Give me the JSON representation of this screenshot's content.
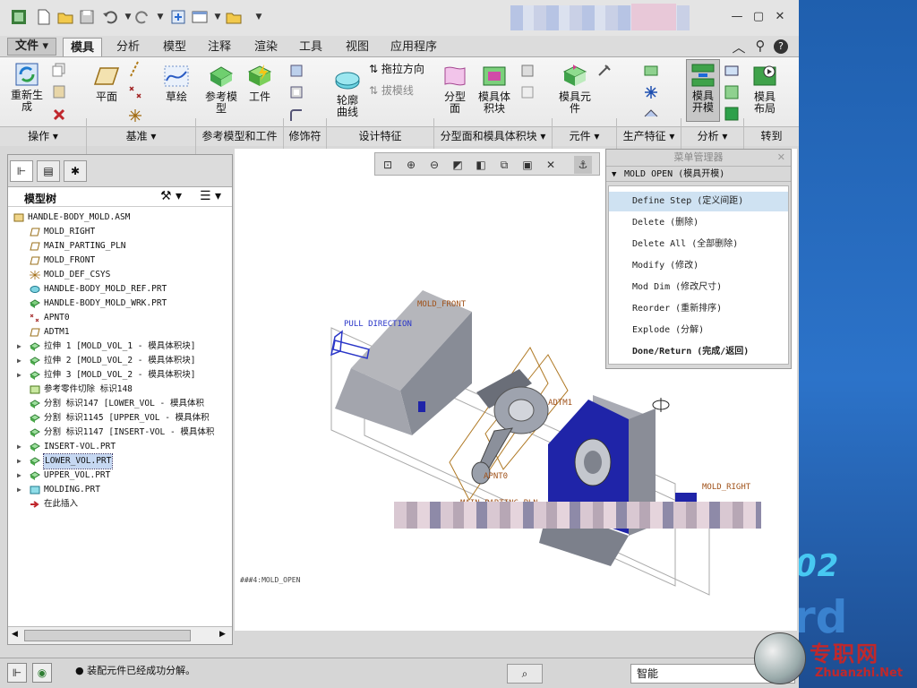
{
  "ribbon_tabs": [
    "文件",
    "模具",
    "分析",
    "模型",
    "注释",
    "渲染",
    "工具",
    "视图",
    "应用程序"
  ],
  "active_tab": "模具",
  "ribbon": {
    "regen": "重新生成",
    "plane": "平面",
    "sketch": "草绘",
    "refmodel": "参考模型",
    "workpiece": "工件",
    "contour_curve": "轮廓曲线",
    "drag_dir": "拖拉方向",
    "draft_line": "拔模线",
    "parting_surface": "分型面",
    "mold_volume": "模具体积块",
    "mold_component": "模具元件",
    "mold_open": "模具开模",
    "mold_layout": "模具布局"
  },
  "groups": [
    "操作",
    "基准",
    "参考模型和工件",
    "修饰符",
    "设计特征",
    "分型面和模具体积块",
    "元件",
    "生产特征",
    "分析",
    "转到"
  ],
  "left_panel": {
    "title": "模型树",
    "tree": [
      {
        "label": "HANDLE-BODY_MOLD.ASM",
        "indent": 0,
        "icon": "asm",
        "exp": ""
      },
      {
        "label": "MOLD_RIGHT",
        "indent": 1,
        "icon": "plane",
        "exp": ""
      },
      {
        "label": "MAIN_PARTING_PLN",
        "indent": 1,
        "icon": "plane",
        "exp": ""
      },
      {
        "label": "MOLD_FRONT",
        "indent": 1,
        "icon": "plane",
        "exp": ""
      },
      {
        "label": "MOLD_DEF_CSYS",
        "indent": 1,
        "icon": "csys",
        "exp": ""
      },
      {
        "label": "HANDLE-BODY_MOLD_REF.PRT",
        "indent": 1,
        "icon": "part",
        "exp": ""
      },
      {
        "label": "HANDLE-BODY_MOLD_WRK.PRT",
        "indent": 1,
        "icon": "part2",
        "exp": ""
      },
      {
        "label": "APNT0",
        "indent": 1,
        "icon": "point",
        "exp": ""
      },
      {
        "label": "ADTM1",
        "indent": 1,
        "icon": "plane",
        "exp": ""
      },
      {
        "label": "拉伸 1 [MOLD_VOL_1 - 模具体积块]",
        "indent": 1,
        "icon": "vol",
        "exp": "▶"
      },
      {
        "label": "拉伸 2 [MOLD_VOL_2 - 模具体积块]",
        "indent": 1,
        "icon": "vol",
        "exp": "▶"
      },
      {
        "label": "拉伸 3 [MOLD_VOL_2 - 模具体积块]",
        "indent": 1,
        "icon": "vol",
        "exp": "▶"
      },
      {
        "label": "参考零件切除 标识148",
        "indent": 1,
        "icon": "cut",
        "exp": ""
      },
      {
        "label": "分割 标识147 [LOWER_VOL - 模具体积",
        "indent": 1,
        "icon": "vol",
        "exp": ""
      },
      {
        "label": "分割 标识1145 [UPPER_VOL - 模具体积",
        "indent": 1,
        "icon": "vol",
        "exp": ""
      },
      {
        "label": "分割 标识1147 [INSERT-VOL - 模具体积",
        "indent": 1,
        "icon": "vol",
        "exp": ""
      },
      {
        "label": "INSERT-VOL.PRT",
        "indent": 1,
        "icon": "vol",
        "exp": "▶"
      },
      {
        "label": "LOWER_VOL.PRT",
        "indent": 1,
        "icon": "vol",
        "exp": "▶",
        "sel": true
      },
      {
        "label": "UPPER_VOL.PRT",
        "indent": 1,
        "icon": "vol",
        "exp": "▶"
      },
      {
        "label": "MOLDING.PRT",
        "indent": 1,
        "icon": "molding",
        "exp": "▶"
      },
      {
        "label": "在此插入",
        "indent": 1,
        "icon": "arrow",
        "exp": ""
      }
    ]
  },
  "viewport": {
    "labels": {
      "pull_direction": "PULL DIRECTION",
      "mold_front": "MOLD_FRONT",
      "adtm1": "ADTM1",
      "apnt0": "APNT0",
      "main_parting": "MAIN_PARTING_PLN",
      "mold_right": "MOLD_RIGHT",
      "view_note": "###4:MOLD_OPEN"
    }
  },
  "menu_manager": {
    "title": "菜单管理器",
    "header": "MOLD OPEN (模具开模)",
    "items": [
      {
        "label": "Define Step (定义间距)",
        "highlight": true
      },
      {
        "label": "Delete (删除)"
      },
      {
        "label": "Delete All (全部删除)"
      },
      {
        "label": "Modify (修改)"
      },
      {
        "label": "Mod Dim (修改尺寸)"
      },
      {
        "label": "Reorder (重新排序)"
      },
      {
        "label": "Explode (分解)"
      },
      {
        "label": "Done/Return (完成/返回)",
        "bold": true
      }
    ]
  },
  "status": {
    "message": "装配元件已经成功分解。",
    "filter": "智能"
  },
  "watermark": {
    "cn": "专职网",
    "en": "Zhuanzhi.Net"
  },
  "side_text": "02"
}
